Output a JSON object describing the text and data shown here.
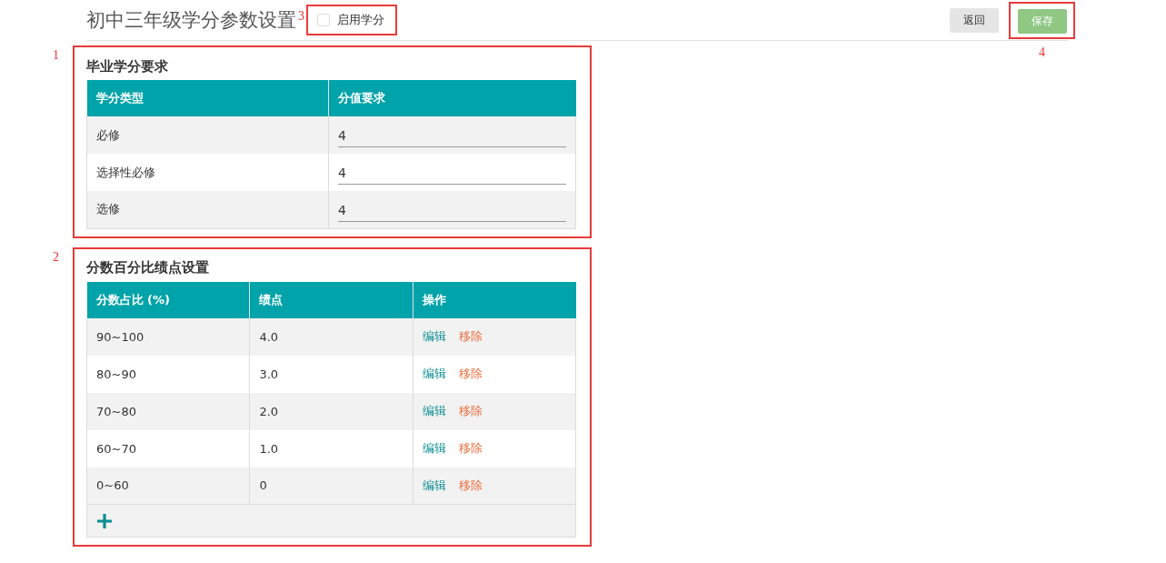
{
  "header": {
    "title": "初中三年级学分参数设置",
    "title_marker": "3",
    "enable_credit": {
      "label": "启用学分",
      "checked": false
    },
    "buttons": [
      {
        "label": "返回",
        "kind": "secondary"
      },
      {
        "label": "保存",
        "kind": "primary"
      }
    ],
    "save_marker": "4"
  },
  "credit_requirements": {
    "marker": "1",
    "title": "毕业学分要求",
    "columns": [
      "学分类型",
      "分值要求"
    ],
    "rows": [
      {
        "type": "必修",
        "value": "4"
      },
      {
        "type": "选择性必修",
        "value": "4"
      },
      {
        "type": "选修",
        "value": "4"
      }
    ]
  },
  "gpa_settings": {
    "marker": "2",
    "title": "分数百分比绩点设置",
    "columns": [
      "分数占比 (%)",
      "绩点",
      "操作"
    ],
    "rows": [
      {
        "range": "90~100",
        "gpa": "4.0",
        "actions": [
          {
            "label": "编辑",
            "kind": "edit"
          },
          {
            "label": "移除",
            "kind": "remove"
          }
        ]
      },
      {
        "range": "80~90",
        "gpa": "3.0",
        "actions": [
          {
            "label": "编辑",
            "kind": "edit"
          },
          {
            "label": "移除",
            "kind": "remove"
          }
        ]
      },
      {
        "range": "70~80",
        "gpa": "2.0",
        "actions": [
          {
            "label": "编辑",
            "kind": "edit"
          },
          {
            "label": "移除",
            "kind": "remove"
          }
        ]
      },
      {
        "range": "60~70",
        "gpa": "1.0",
        "actions": [
          {
            "label": "编辑",
            "kind": "edit"
          },
          {
            "label": "移除",
            "kind": "remove"
          }
        ]
      },
      {
        "range": "0~60",
        "gpa": "0",
        "actions": [
          {
            "label": "编辑",
            "kind": "edit"
          },
          {
            "label": "移除",
            "kind": "remove"
          }
        ]
      }
    ]
  }
}
